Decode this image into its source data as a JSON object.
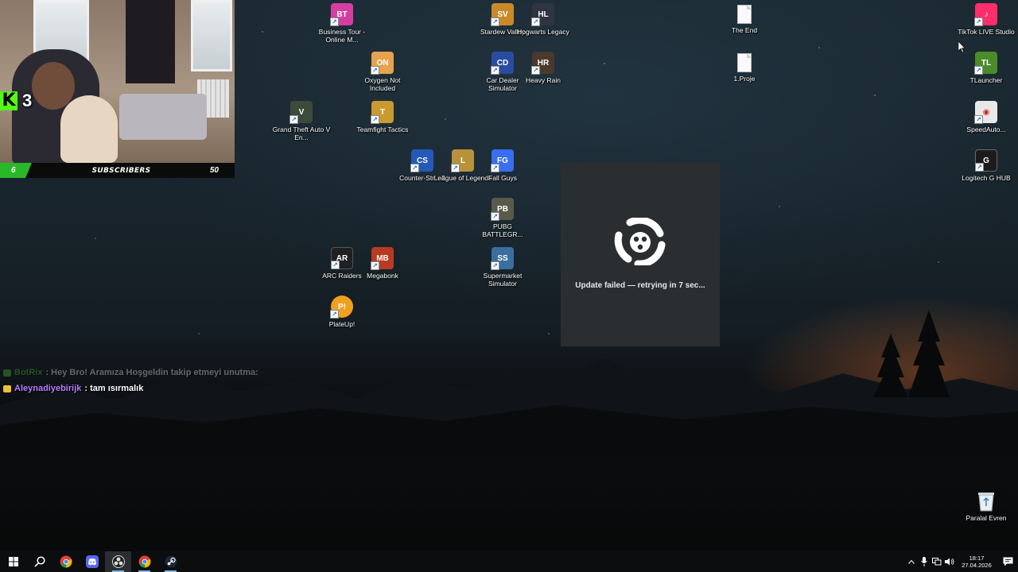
{
  "webcam": {
    "kick_count": "3",
    "kick_logo_letter": "K",
    "subscribers_current": "6",
    "subscribers_label": "SUBSCRIBERS",
    "subscribers_goal": "50"
  },
  "chat": [
    {
      "user": "BotRix",
      "message": ": Hey Bro! Aramıza Hoşgeldin takip etmeyi unutma:"
    },
    {
      "user": "Aleynadiyebirijk",
      "message": ": tam ısırmalık"
    }
  ],
  "desktop_icons": [
    {
      "label": "Business Tour - Online M...",
      "icon": "business-tour-icon",
      "color": "#d43ea0"
    },
    {
      "label": "Stardew Valley",
      "icon": "stardew-valley-icon",
      "color": "#c98a2a"
    },
    {
      "label": "Hogwarts Legacy",
      "icon": "hogwarts-legacy-icon",
      "color": "#2f3442"
    },
    {
      "label": "The End",
      "icon": "text-file-icon"
    },
    {
      "label": "TikTok LIVE Studio",
      "icon": "tiktok-live-studio-icon",
      "color": "#ff2d6a"
    },
    {
      "label": "Oxygen Not Included",
      "icon": "oxygen-not-included-icon",
      "color": "#e6a24c"
    },
    {
      "label": "Car Dealer Simulator",
      "icon": "car-dealer-simulator-icon",
      "color": "#2a4ca0"
    },
    {
      "label": "Heavy Rain",
      "icon": "heavy-rain-icon",
      "color": "#4a3a2e"
    },
    {
      "label": "1.Proje",
      "icon": "text-file-icon"
    },
    {
      "label": "TLauncher",
      "icon": "tlauncher-icon",
      "color": "#4b8b2a"
    },
    {
      "label": "Grand Theft Auto V En...",
      "icon": "gta-v-icon",
      "color": "#3b4a3a"
    },
    {
      "label": "Teamfight Tactics",
      "icon": "teamfight-tactics-icon",
      "color": "#c99a2e"
    },
    {
      "label": "SpeedAuto...",
      "icon": "speed-autoclicker-icon",
      "color": "#e8e8e8"
    },
    {
      "label": "Counter-Str... 2",
      "icon": "counter-strike-2-icon",
      "color": "#2459b8"
    },
    {
      "label": "League of Legends",
      "icon": "league-of-legends-icon",
      "color": "#b8923a"
    },
    {
      "label": "Fall Guys",
      "icon": "fall-guys-icon",
      "color": "#3a6ef0"
    },
    {
      "label": "Logitech G HUB",
      "icon": "logitech-g-hub-icon",
      "color": "#1b1b1b"
    },
    {
      "label": "PUBG BATTLEGR...",
      "icon": "pubg-icon",
      "color": "#5a5a4a"
    },
    {
      "label": "ARC Raiders",
      "icon": "arc-raiders-icon",
      "color": "#202020"
    },
    {
      "label": "Megabonk",
      "icon": "megabonk-icon",
      "color": "#b83a22"
    },
    {
      "label": "Supermarket Simulator",
      "icon": "supermarket-simulator-icon",
      "color": "#3a6e9e"
    },
    {
      "label": "PlateUp!",
      "icon": "plateup-icon",
      "color": "#f0a020"
    },
    {
      "label": "Paralal Evren",
      "icon": "recycle-bin-icon"
    }
  ],
  "update_dialog": {
    "status": "Update failed — retrying in 7 sec..."
  },
  "taskbar": {
    "apps": [
      "start-icon",
      "search-icon",
      "chrome-icon",
      "discord-icon",
      "obs-icon",
      "chrome-alt-icon",
      "steam-icon"
    ],
    "time": "18:17",
    "date": "27.04.2026"
  },
  "colors": {
    "kick_green": "#53fc18",
    "bot_name": "#53c23a",
    "user_name": "#b67cff",
    "dialog_bg": "#2b2e31",
    "taskbar_bg": "#0b0d0f"
  }
}
